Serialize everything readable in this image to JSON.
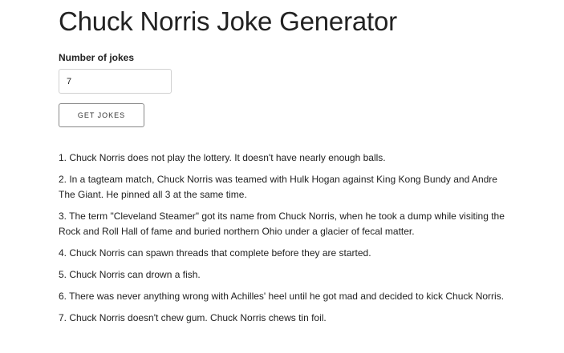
{
  "page": {
    "title": "Chuck Norris Joke Generator"
  },
  "form": {
    "count_label": "Number of jokes",
    "count_value": "7",
    "get_button_label": "GET JOKES"
  },
  "jokes": [
    "1. Chuck Norris does not play the lottery. It doesn't have nearly enough balls.",
    "2. In a tagteam match, Chuck Norris was teamed with Hulk Hogan against King Kong Bundy and Andre The Giant. He pinned all 3 at the same time.",
    "3. The term \"Cleveland Steamer\" got its name from Chuck Norris, when he took a dump while visiting the Rock and Roll Hall of fame and buried northern Ohio under a glacier of fecal matter.",
    "4. Chuck Norris can spawn threads that complete before they are started.",
    "5. Chuck Norris can drown a fish.",
    "6. There was never anything wrong with Achilles' heel until he got mad and decided to kick Chuck Norris.",
    "7. Chuck Norris doesn't chew gum. Chuck Norris chews tin foil."
  ]
}
